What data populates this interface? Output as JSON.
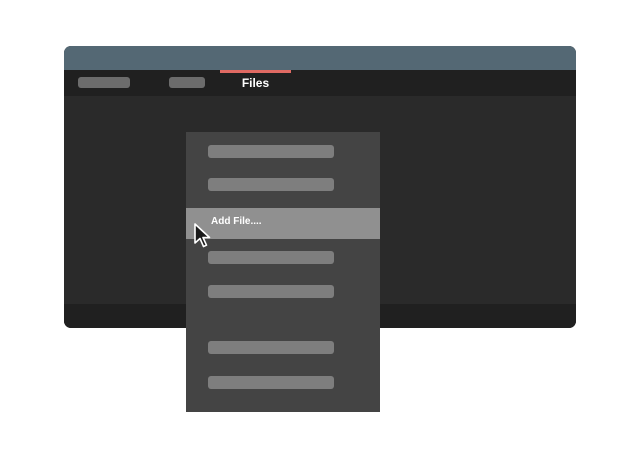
{
  "window": {
    "colors": {
      "titlebar": "#546874",
      "tabbar": "#202020",
      "active_tab_indicator": "#e06a63",
      "body": "#2a2a2a"
    }
  },
  "tabs": {
    "active_label": "Files"
  },
  "menu": {
    "highlighted_label": "Add File...."
  },
  "icons": {
    "cursor": "mouse-pointer-icon"
  }
}
